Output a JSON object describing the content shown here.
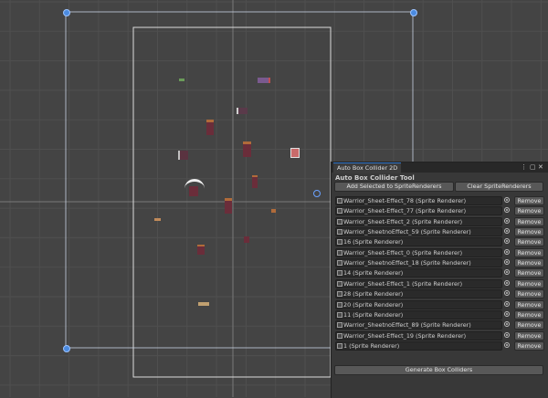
{
  "window": {
    "tab_title": "Auto Box Collider 2D",
    "menu_icon": "kebab-menu-icon",
    "maximize_icon": "maximize-icon",
    "close_icon": "close-icon"
  },
  "tool": {
    "title": "Auto Box Collider Tool",
    "add_button": "Add Selected to SpriteRenderers",
    "clear_button": "Clear SpriteRenderers",
    "generate_button": "Generate Box Colliders",
    "remove_label": "Remove"
  },
  "renderers": [
    "Warrior_Sheet-Effect_78 (Sprite Renderer)",
    "Warrior_Sheet-Effect_77 (Sprite Renderer)",
    "Warrior_Sheet-Effect_2 (Sprite Renderer)",
    "Warrior_SheetnoEffect_59 (Sprite Renderer)",
    "16 (Sprite Renderer)",
    "Warrior_Sheet-Effect_0 (Sprite Renderer)",
    "Warrior_SheetnoEffect_18 (Sprite Renderer)",
    "14 (Sprite Renderer)",
    "Warrior_Sheet-Effect_1 (Sprite Renderer)",
    "28 (Sprite Renderer)",
    "20 (Sprite Renderer)",
    "11 (Sprite Renderer)",
    "Warrior_SheetnoEffect_89 (Sprite Renderer)",
    "Warrior_Sheet-Effect_19 (Sprite Renderer)",
    "1 (Sprite Renderer)"
  ],
  "colors": {
    "scene_background": "#444444",
    "grid_line": "#4f4f4f",
    "camera_frame": "#d8d8d8",
    "selection_rect": "#cfd8e6",
    "handle": "#4b8be0",
    "panel_background": "#383838",
    "tab_accent": "#2d73c9"
  }
}
